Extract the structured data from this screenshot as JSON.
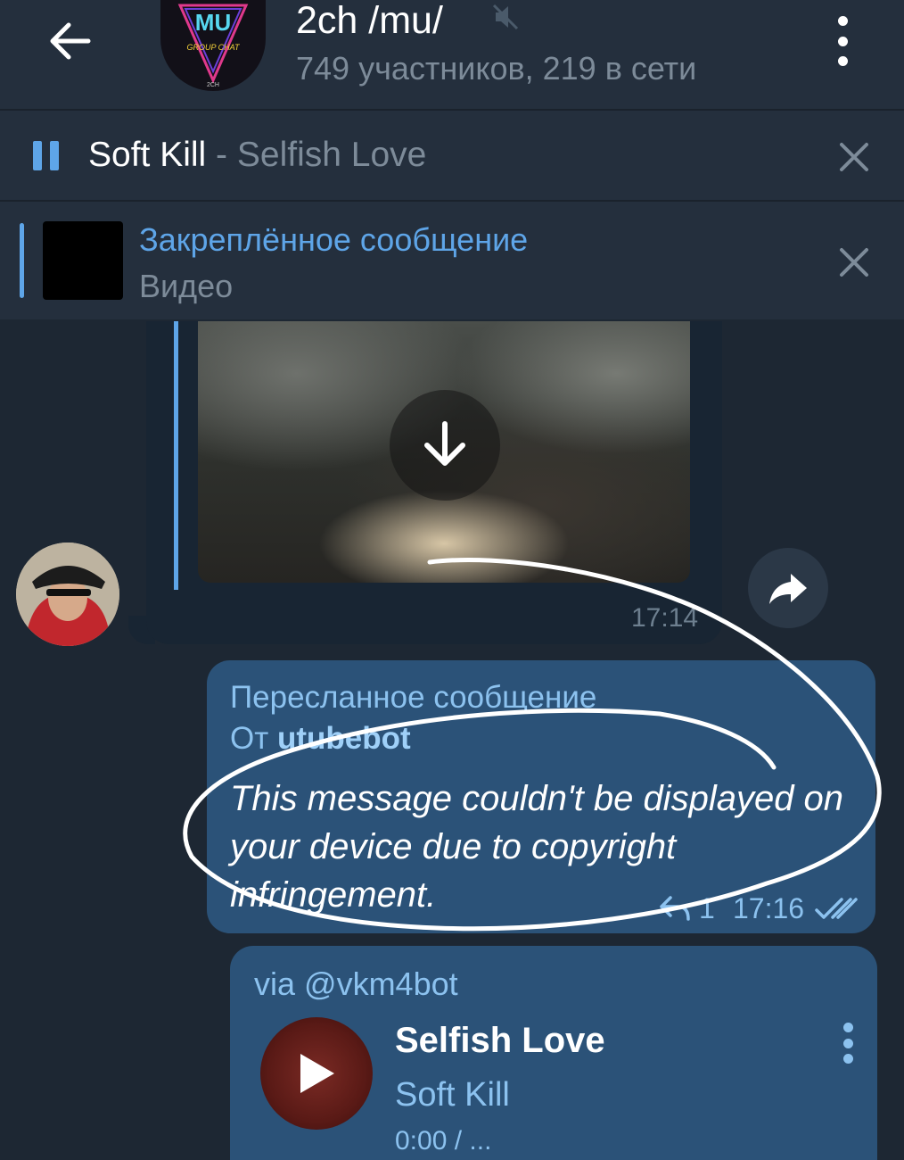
{
  "header": {
    "title": "2ch /mu/",
    "subtitle": "749 участников, 219 в сети",
    "avatar_text": "MU",
    "avatar_subtext": "GROUP CHAT",
    "avatar_corner": "2CH"
  },
  "player": {
    "track_title": "Soft Kill",
    "track_rest": " - Selfish Love"
  },
  "pinned": {
    "title": "Закреплённое сообщение",
    "subtitle": "Видео"
  },
  "incoming": {
    "time": "17:14"
  },
  "forwarded": {
    "label": "Пересланное сообщение",
    "from_prefix": "От ",
    "from_name": "utubebot",
    "text": "This message couldn't be displayed on your device due to copyright infringement.",
    "replies": "1",
    "time": "17:16"
  },
  "audio_message": {
    "via": "via @vkm4bot",
    "title": "Selfish Love",
    "artist": "Soft Kill",
    "progress": "0:00 / ..."
  },
  "colors": {
    "background": "#1d2733",
    "header": "#242f3d",
    "accent": "#5ea5e8",
    "outgoing_bubble": "#2b5278",
    "incoming_bubble": "#182533"
  }
}
